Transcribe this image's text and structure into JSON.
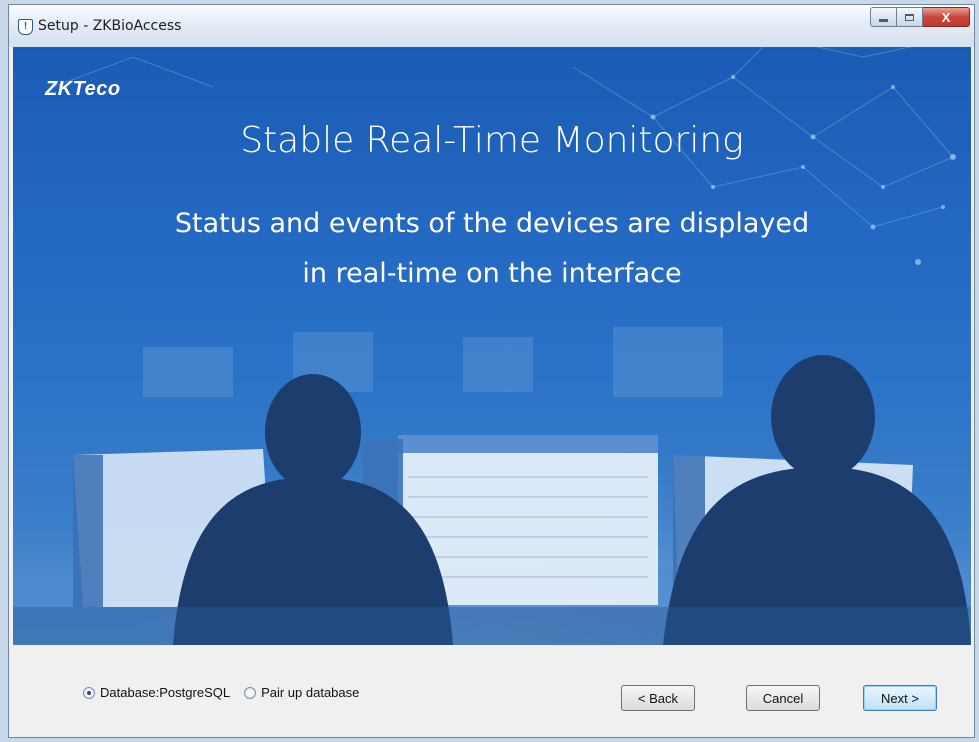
{
  "window": {
    "title": "Setup - ZKBioAccess",
    "close_glyph": "X"
  },
  "banner": {
    "brand": "ZKTeco",
    "headline": "Stable Real-Time Monitoring",
    "subline_1": "Status and events of the devices are displayed",
    "subline_2": "in real-time on the interface"
  },
  "footer": {
    "radios": [
      {
        "label": "Database:PostgreSQL",
        "checked": true
      },
      {
        "label": "Pair up database",
        "checked": false
      }
    ],
    "back_label": "< Back",
    "cancel_label": "Cancel",
    "next_label": "Next >"
  }
}
